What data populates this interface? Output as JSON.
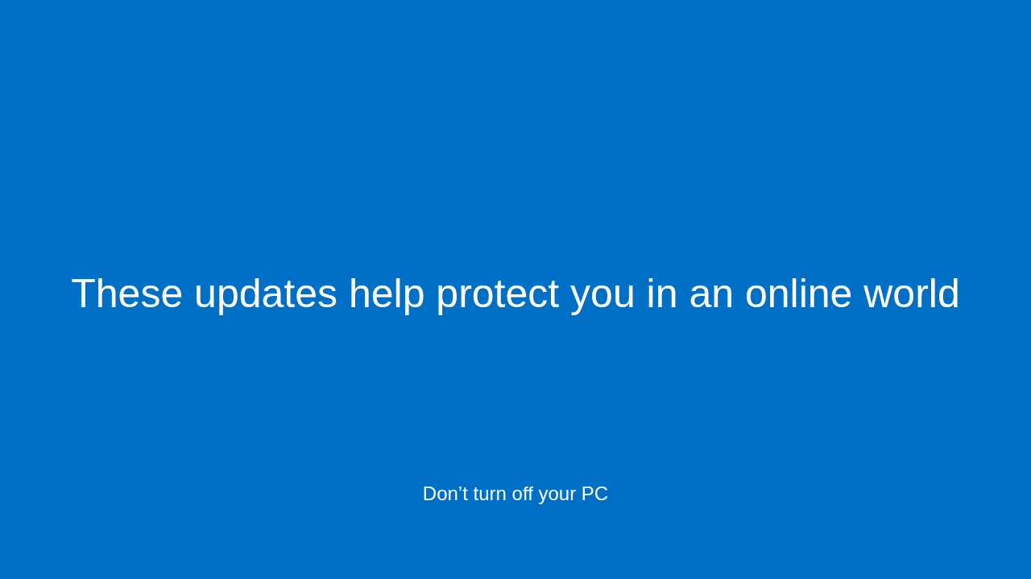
{
  "heading": "These updates help protect you in an online world",
  "footer": "Don’t turn off your PC"
}
